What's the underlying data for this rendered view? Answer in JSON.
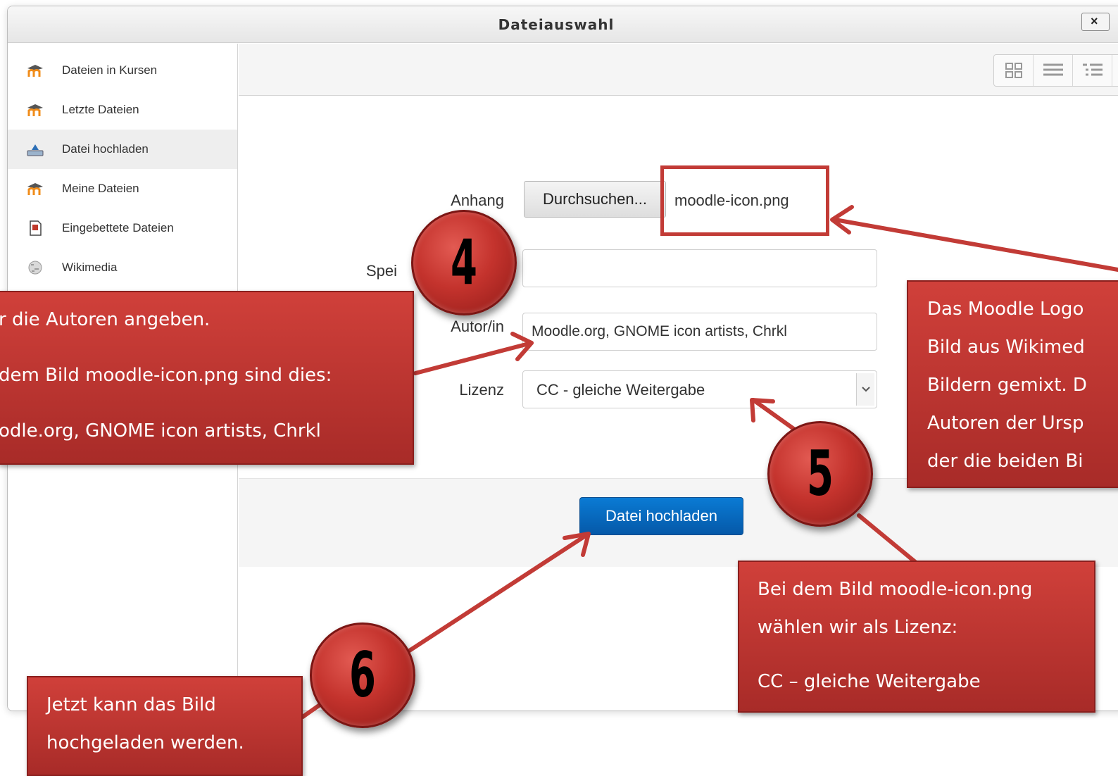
{
  "dialog": {
    "title": "Dateiauswahl",
    "close_label": "×"
  },
  "sidebar": {
    "items": [
      {
        "label": "Dateien in Kursen",
        "icon": "moodle-icon"
      },
      {
        "label": "Letzte Dateien",
        "icon": "moodle-icon"
      },
      {
        "label": "Datei hochladen",
        "icon": "upload-icon",
        "active": true
      },
      {
        "label": "Meine Dateien",
        "icon": "moodle-icon"
      },
      {
        "label": "Eingebettete Dateien",
        "icon": "document-icon"
      },
      {
        "label": "Wikimedia",
        "icon": "wikimedia-globe-icon"
      }
    ]
  },
  "toolbar": {
    "views": [
      "grid-view-icon",
      "list-view-icon",
      "tree-view-icon"
    ]
  },
  "form": {
    "attachment_label": "Anhang",
    "browse_label": "Durchsuchen...",
    "file_name": "moodle-icon.png",
    "save_as_label": "Spei",
    "save_as_value": "",
    "author_label": "Autor/in",
    "author_value": "Moodle.org, GNOME icon artists, Chrkl",
    "license_label": "Lizenz",
    "license_value": "CC - gleiche Weitergabe",
    "upload_label": "Datei hochladen"
  },
  "annotations": {
    "left_callout": [
      "r die Autoren angeben.",
      "dem Bild moodle-icon.png sind dies:",
      "odle.org, GNOME icon artists, Chrkl"
    ],
    "right_callout": [
      "Das Moodle Logo",
      "Bild aus Wikimed",
      "Bildern gemixt. D",
      "Autoren der Ursp",
      "der die beiden Bi"
    ],
    "license_callout": [
      "Bei dem Bild moodle-icon.png",
      "wählen wir als Lizenz:",
      "CC – gleiche Weitergabe"
    ],
    "upload_callout": [
      "Jetzt kann das Bild",
      "hochgeladen werden."
    ],
    "badges": [
      "4",
      "5",
      "6"
    ],
    "accent_color": "#c23b36",
    "button_color": "#0668b8"
  }
}
